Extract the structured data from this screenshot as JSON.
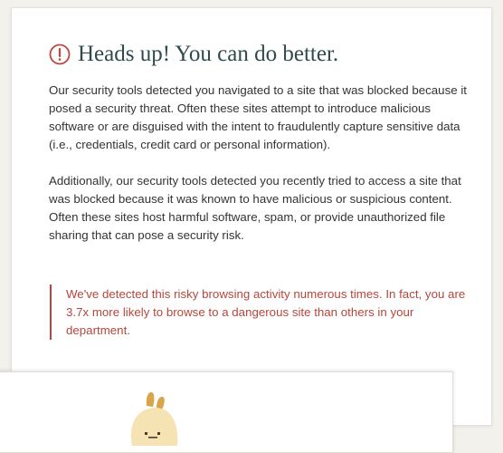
{
  "alert": {
    "icon": "alert-circle-icon",
    "title": "Heads up! You can do better.",
    "paragraphs": [
      "Our security tools detected you navigated to a site that was blocked because it posed a security threat. Often these sites attempt to introduce malicious software or are disguised with the intent to fraudulently capture sensitive data (i.e., credentials, credit card or personal information).",
      "Additionally, our security tools detected you recently tried to access a site that was blocked because it was known to have malicious or suspicious content. Often these sites host harmful software, spam, or provide unauthorized file sharing that can pose a security risk."
    ],
    "callout": "We've detected this risky browsing activity numerous times. In fact, you are 3.7x more likely to browse to a dangerous site than others in your department."
  },
  "colors": {
    "title": "#2e4a4d",
    "alert_red": "#c0473b",
    "callout_text": "#b5463c",
    "body_text": "#333333",
    "background": "#f3f1ec",
    "mascot_body": "#f5e3b3",
    "mascot_horns": "#d9a54a"
  },
  "mascot": {
    "icon": "mascot-creature-icon"
  }
}
